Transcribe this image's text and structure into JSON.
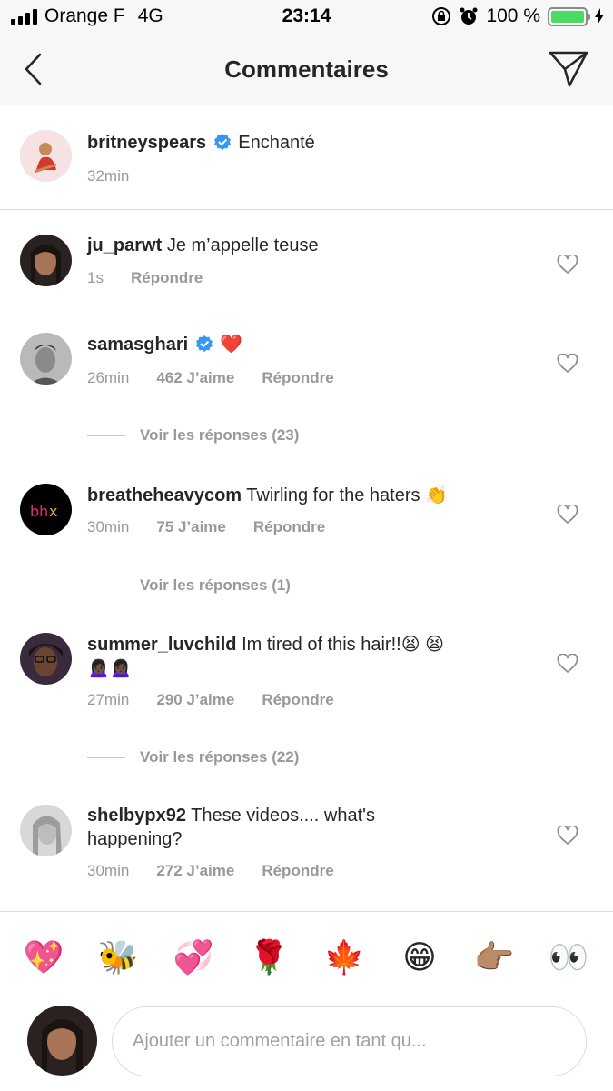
{
  "status_bar": {
    "carrier": "Orange F",
    "network": "4G",
    "time": "23:14",
    "battery": "100 %",
    "battery_level": 1.0
  },
  "header": {
    "title": "Commentaires"
  },
  "caption": {
    "username": "britneyspears",
    "verified": true,
    "text": "Enchanté",
    "time": "32min"
  },
  "comments": [
    {
      "username": "ju_parwt",
      "text": "Je m’appelle teuse",
      "time": "1s",
      "likes": "",
      "reply": "Répondre"
    },
    {
      "username": "samasghari",
      "verified": true,
      "text": "❤️",
      "time": "26min",
      "likes": "462 J’aime",
      "reply": "Répondre",
      "view_replies": "Voir les réponses (23)"
    },
    {
      "username": "breatheheavycom",
      "text": "Twirling for the haters 👏",
      "time": "30min",
      "likes": "75 J’aime",
      "reply": "Répondre",
      "view_replies": "Voir les réponses (1)"
    },
    {
      "username": "summer_luvchild",
      "text": "Im tired of this hair!!😫 😫",
      "text_line2": "🙍🏿‍♀️🙍🏿‍♀️",
      "time": "27min",
      "likes": "290 J’aime",
      "reply": "Répondre",
      "view_replies": "Voir les réponses (22)"
    },
    {
      "username": "shelbypx92",
      "text": "These videos.... what's",
      "text_line2": "happening?",
      "time": "30min",
      "likes": "272 J’aime",
      "reply": "Répondre"
    }
  ],
  "emoji_bar": [
    "💖",
    "🐝",
    "💞",
    "🌹",
    "🍁",
    "😁",
    "👉🏽",
    "👀"
  ],
  "comment_input": {
    "placeholder": "Ajouter un commentaire en tant qu..."
  },
  "colors": {
    "verified_blue": "#3897f0",
    "muted_text": "#999999",
    "battery_green": "#4cd964"
  }
}
